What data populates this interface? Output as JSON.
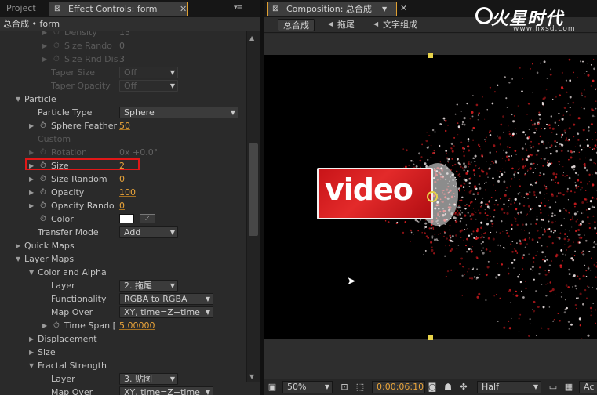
{
  "left_panel": {
    "tabs": [
      {
        "label": "Project"
      },
      {
        "label": "Effect Controls: form"
      }
    ],
    "breadcrumb": "总合成 • form",
    "rows": [
      {
        "indent": 3,
        "twirl": "▶",
        "stopwatch": true,
        "label": "Density",
        "value": "15",
        "dim": true
      },
      {
        "indent": 3,
        "twirl": "▶",
        "stopwatch": true,
        "label": "Size Rando",
        "value": "0",
        "dim": true
      },
      {
        "indent": 3,
        "twirl": "▶",
        "stopwatch": true,
        "label": "Size Rnd Dis",
        "value": "3",
        "dim": true
      },
      {
        "indent": 3,
        "label": "Taper Size",
        "dropdown": "Off",
        "dim": true
      },
      {
        "indent": 3,
        "label": "Taper Opacity",
        "dropdown": "Off",
        "dim": true
      },
      {
        "indent": 1,
        "twirl": "▼",
        "label": "Particle"
      },
      {
        "indent": 2,
        "label": "Particle Type",
        "dropdown": "Sphere",
        "wide": true
      },
      {
        "indent": 2,
        "twirl": "▶",
        "stopwatch": true,
        "label": "Sphere Feather",
        "value": "50"
      },
      {
        "indent": 2,
        "label": "Custom",
        "dim": true
      },
      {
        "indent": 2,
        "twirl": "▶",
        "stopwatch": true,
        "label": "Rotation",
        "value": "0x +0.0°",
        "dim": true
      },
      {
        "indent": 2,
        "twirl": "▶",
        "stopwatch": true,
        "label": "Size",
        "value": "2"
      },
      {
        "indent": 2,
        "twirl": "▶",
        "stopwatch": true,
        "label": "Size Random",
        "value": "0"
      },
      {
        "indent": 2,
        "twirl": "▶",
        "stopwatch": true,
        "label": "Opacity",
        "value": "100"
      },
      {
        "indent": 2,
        "twirl": "▶",
        "stopwatch": true,
        "label": "Opacity Rando",
        "value": "0"
      },
      {
        "indent": 2,
        "stopwatch": true,
        "label": "Color",
        "color": "#ffffff"
      },
      {
        "indent": 2,
        "label": "Transfer Mode",
        "dropdown": "Add"
      },
      {
        "indent": 1,
        "twirl": "▶",
        "label": "Quick Maps"
      },
      {
        "indent": 1,
        "twirl": "▼",
        "label": "Layer Maps"
      },
      {
        "indent": 2,
        "twirl": "▼",
        "label": "Color and Alpha"
      },
      {
        "indent": 3,
        "label": "Layer",
        "dropdown": "2. 拖尾"
      },
      {
        "indent": 3,
        "label": "Functionality",
        "dropdown": "RGBA to RGBA"
      },
      {
        "indent": 3,
        "label": "Map Over",
        "dropdown": "XY, time=Z+time"
      },
      {
        "indent": 3,
        "twirl": "▶",
        "stopwatch": true,
        "label": "Time Span [",
        "value": "5.00000"
      },
      {
        "indent": 2,
        "twirl": "▶",
        "label": "Displacement"
      },
      {
        "indent": 2,
        "twirl": "▶",
        "label": "Size"
      },
      {
        "indent": 2,
        "twirl": "▼",
        "label": "Fractal Strength"
      },
      {
        "indent": 3,
        "label": "Layer",
        "dropdown": "3. 贴图"
      },
      {
        "indent": 3,
        "label": "Map Over",
        "dropdown": "XY, time=Z+time"
      }
    ]
  },
  "right_panel": {
    "tab": {
      "label": "Composition: 总合成"
    },
    "flowchart": [
      "总合成",
      "拖尾",
      "文字组成"
    ],
    "logo": {
      "brand": "火星时代",
      "url": "www.hxsd.com"
    },
    "comp_text": "video",
    "status": {
      "zoom": "50%",
      "timecode": "0:00:06:10",
      "resolution": "Half",
      "trailing": "Ac"
    }
  },
  "colors": {
    "accent": "#e9a43a",
    "highlight_box": "#e01818",
    "logo_red": "#d41c20",
    "handles": "#e8d34a"
  }
}
